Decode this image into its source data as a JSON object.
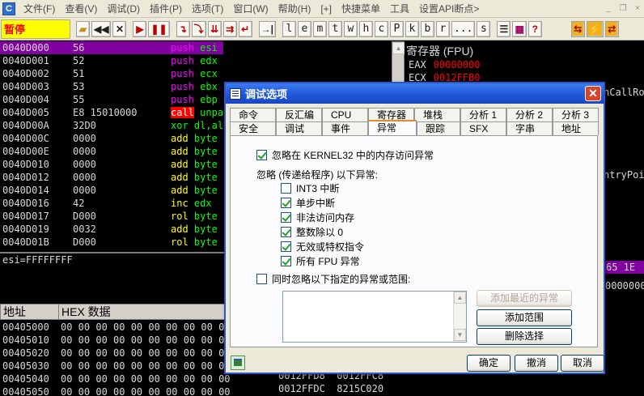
{
  "menubar": {
    "items": [
      "文件(F)",
      "查看(V)",
      "调试(D)",
      "插件(P)",
      "选项(T)",
      "窗口(W)",
      "帮助(H)",
      "[+]",
      "快捷菜单",
      "工具",
      "设置API断点>"
    ],
    "app_icon_letter": "C"
  },
  "toolbar": {
    "status": "暂停",
    "letter_buttons": [
      "l",
      "e",
      "m",
      "t",
      "w",
      "h",
      "c",
      "P",
      "k",
      "b",
      "r",
      "...",
      "s"
    ]
  },
  "disasm": {
    "rows": [
      {
        "addr": "0040D000",
        "hex": "56",
        "mn": "push",
        "op": "esi",
        "cls": "m"
      },
      {
        "addr": "0040D001",
        "hex": "52",
        "mn": "push",
        "op": "edx",
        "cls": "m"
      },
      {
        "addr": "0040D002",
        "hex": "51",
        "mn": "push",
        "op": "ecx",
        "cls": "m"
      },
      {
        "addr": "0040D003",
        "hex": "53",
        "mn": "push",
        "op": "ebx",
        "cls": "m"
      },
      {
        "addr": "0040D004",
        "hex": "55",
        "mn": "push",
        "op": "ebp",
        "cls": "m"
      },
      {
        "addr": "0040D005",
        "hex": "E8 15010000",
        "mn": "call",
        "op": "unpa",
        "cls": "call"
      },
      {
        "addr": "0040D00A",
        "hex": "32D0",
        "mn": "xor",
        "op": "dl,al",
        "cls": "g"
      },
      {
        "addr": "0040D00C",
        "hex": "0000",
        "mn": "add",
        "op": "byte",
        "cls": ""
      },
      {
        "addr": "0040D00E",
        "hex": "0000",
        "mn": "add",
        "op": "byte",
        "cls": ""
      },
      {
        "addr": "0040D010",
        "hex": "0000",
        "mn": "add",
        "op": "byte",
        "cls": ""
      },
      {
        "addr": "0040D012",
        "hex": "0000",
        "mn": "add",
        "op": "byte",
        "cls": ""
      },
      {
        "addr": "0040D014",
        "hex": "0000",
        "mn": "add",
        "op": "byte",
        "cls": ""
      },
      {
        "addr": "0040D016",
        "hex": "42",
        "mn": "inc",
        "op": "edx",
        "cls": ""
      },
      {
        "addr": "0040D017",
        "hex": "D000",
        "mn": "rol",
        "op": "byte",
        "cls": ""
      },
      {
        "addr": "0040D019",
        "hex": "0032",
        "mn": "add",
        "op": "byte",
        "cls": ""
      },
      {
        "addr": "0040D01B",
        "hex": "D000",
        "mn": "rol",
        "op": "byte",
        "cls": ""
      }
    ]
  },
  "info": {
    "line": "esi=FFFFFFFF"
  },
  "dump": {
    "header_addr": "地址",
    "header_hex": "HEX 数据",
    "rows": [
      {
        "addr": "00405000",
        "bytes": "00 00 00 00 00 00 00 00 00 00"
      },
      {
        "addr": "00405010",
        "bytes": "00 00 00 00 00 00 00 00 00 00"
      },
      {
        "addr": "00405020",
        "bytes": "00 00 00 00 00 00 00 00 00 00"
      },
      {
        "addr": "00405030",
        "bytes": "00 00 00 00 00 00 00 00 00 00"
      },
      {
        "addr": "00405040",
        "bytes": "00 00 00 00 00 00 00 00 00 00"
      },
      {
        "addr": "00405050",
        "bytes": "00 00 00 00 00 00 00 00 00 00"
      }
    ]
  },
  "registers": {
    "title": "寄存器 (FPU)",
    "rows": [
      {
        "name": "EAX",
        "value": "00000000"
      },
      {
        "name": "ECX",
        "value": "0012FFB0"
      }
    ],
    "partial_1": "nCallRo",
    "partial_2": "ntryPoi",
    "partial_3": "0000000"
  },
  "stack": {
    "bar_text": "65 1E",
    "rows": [
      {
        "addr": "0012FFD8",
        "value": "0012FFC8"
      },
      {
        "addr": "0012FFDC",
        "value": "8215C020"
      }
    ]
  },
  "dialog": {
    "title": "调试选项",
    "tabs_row1": [
      "命令",
      "反汇编",
      "CPU",
      "寄存器",
      "堆栈",
      "分析 1",
      "分析 2",
      "分析 3"
    ],
    "tabs_row2": [
      "安全",
      "调试",
      "事件",
      "异常",
      "跟踪",
      "SFX",
      "字串",
      "地址"
    ],
    "active_tab": "异常",
    "ignore_kernel32": "忽略在 KERNEL32 中的内存访问异常",
    "ignore_group": "忽略 (传递给程序) 以下异常:",
    "exceptions": [
      {
        "label": "INT3 中断",
        "checked": false
      },
      {
        "label": "单步中断",
        "checked": true
      },
      {
        "label": "非法访问内存",
        "checked": true
      },
      {
        "label": "整数除以 0",
        "checked": true
      },
      {
        "label": "无效或特权指令",
        "checked": true
      },
      {
        "label": "所有 FPU 异常",
        "checked": true
      }
    ],
    "ignore_ranges": "同时忽略以下指定的异常或范围:",
    "btn_add_last": "添加最近的异常",
    "btn_add_range": "添加范围",
    "btn_delete": "删除选择",
    "btn_ok": "确定",
    "btn_cancel": "撤消",
    "btn_close": "取消"
  }
}
